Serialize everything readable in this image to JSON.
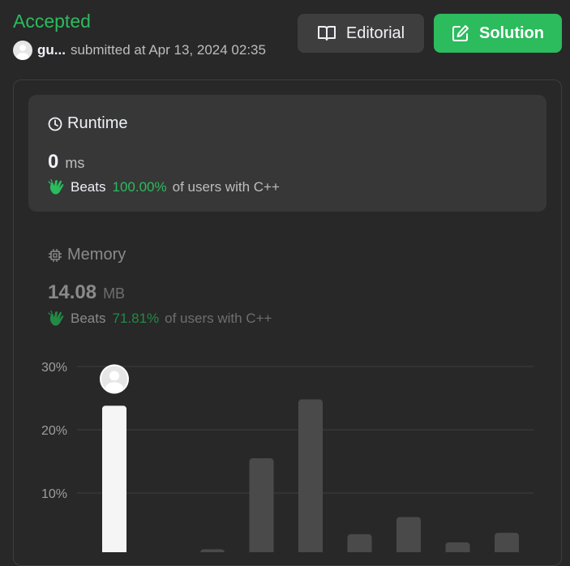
{
  "header": {
    "status": "Accepted",
    "username": "gu...",
    "submitted_text": "submitted at Apr 13, 2024 02:35",
    "editorial_label": "Editorial",
    "solution_label": "Solution"
  },
  "runtime": {
    "title": "Runtime",
    "value": "0",
    "unit": "ms",
    "beats_label": "Beats",
    "beats_percent": "100.00%",
    "beats_suffix": "of users with C++"
  },
  "memory": {
    "title": "Memory",
    "value": "14.08",
    "unit": "MB",
    "beats_label": "Beats",
    "beats_percent": "71.81%",
    "beats_suffix": "of users with C++"
  },
  "colors": {
    "accent": "#2cbb5d",
    "background": "#282828",
    "card": "#373737",
    "bar": "#4a4a4a",
    "bar_highlight": "#f5f5f5"
  },
  "chart_data": {
    "type": "bar",
    "ylabel": "",
    "xlabel": "",
    "y_ticks": [
      "10%",
      "20%",
      "30%"
    ],
    "tick_values": [
      10,
      20,
      30
    ],
    "values": [
      23.8,
      0,
      1.1,
      15.5,
      24.8,
      3.5,
      6.2,
      2.2,
      3.7
    ],
    "highlight_index": 0,
    "ylim": [
      0,
      30
    ],
    "grid": true
  }
}
